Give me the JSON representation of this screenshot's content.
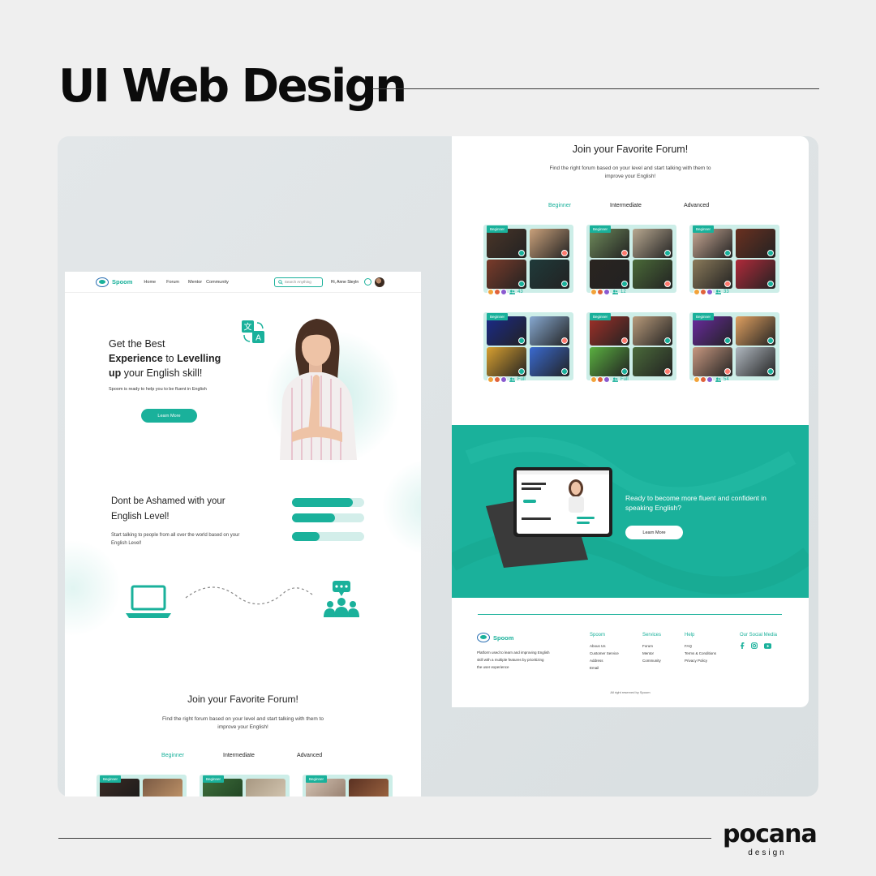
{
  "page": {
    "title": "UI Web Design",
    "brand_name": "pocana",
    "brand_sub": "design"
  },
  "colors": {
    "primary": "#1ab19b",
    "primary_light": "#cdeee8",
    "logo_blue": "#2a6fb3"
  },
  "nav": {
    "logo": "Spoom",
    "links": [
      "Home",
      "Forum",
      "Mentor",
      "Community"
    ],
    "search_placeholder": "Search Anything",
    "user": "Hi, Anne Steyln"
  },
  "hero": {
    "line1": "Get the Best",
    "line2_bold": "Experience",
    "line2_rest": " to ",
    "line2_bold2": "Levelling",
    "line3_bold": "up",
    "line3_rest": " your English skill!",
    "subtitle": "Spoom is ready to help you to be fluent in English",
    "button": "Learn More"
  },
  "section2": {
    "heading_line1": "Dont be Ashamed with your",
    "heading_line2": "English Level!",
    "text": "Start talking to people from all over the world based on your English Level!",
    "levels": [
      0.84,
      0.59,
      0.38
    ]
  },
  "forum": {
    "heading": "Join your Favorite Forum!",
    "subtitle_line1": "Find the right forum based on your level and start talking with them to",
    "subtitle_line2": "improve your English!",
    "tabs": [
      "Beginner",
      "Intermediate",
      "Advanced"
    ],
    "badge": "Beginner",
    "counts": [
      "43",
      "12",
      "33",
      "Full",
      "Full",
      "54"
    ]
  },
  "cta": {
    "text": "Ready to become more fluent and confident in speaking English?",
    "button": "Learn More"
  },
  "footer": {
    "logo": "Spoom",
    "description": "Platform used to learn and improving English skill with a multiple features by prioritizing the user experience",
    "col_spoom": {
      "title": "Spoom",
      "items": [
        "Abous Us",
        "Customer Service",
        "Address",
        "Email"
      ]
    },
    "col_services": {
      "title": "Services",
      "items": [
        "Forum",
        "Mentor",
        "Community"
      ]
    },
    "col_help": {
      "title": "Help",
      "items": [
        "FAQ",
        "Terms & Conditions",
        "Privacy Policy"
      ]
    },
    "social_title": "Our Social Media",
    "copyright": "All right reserved by Spoom"
  }
}
